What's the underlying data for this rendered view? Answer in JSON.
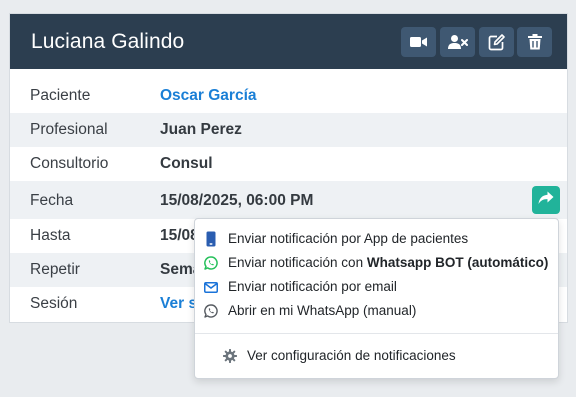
{
  "header": {
    "title": "Luciana Galindo",
    "buttons": [
      {
        "name": "video-call-button",
        "icon": "video-icon"
      },
      {
        "name": "remove-patient-button",
        "icon": "user-remove-icon"
      },
      {
        "name": "edit-button",
        "icon": "edit-icon"
      },
      {
        "name": "delete-button",
        "icon": "trash-icon"
      }
    ]
  },
  "details": {
    "paciente": {
      "label": "Paciente",
      "value": "Oscar García"
    },
    "profesional": {
      "label": "Profesional",
      "value": "Juan Perez"
    },
    "consultorio": {
      "label": "Consultorio",
      "value": "Consul"
    },
    "fecha": {
      "label": "Fecha",
      "value": "15/08/2025, 06:00 PM"
    },
    "hasta": {
      "label": "Hasta",
      "value": "15/08"
    },
    "repetir": {
      "label": "Repetir",
      "value": "Sema"
    },
    "sesion": {
      "label": "Sesión",
      "value": "Ver s"
    }
  },
  "notify_menu": {
    "app": "Enviar notificación por App de pacientes",
    "whatsapp_bot_prefix": "Enviar notificación con ",
    "whatsapp_bot_bold": "Whatsapp BOT (automático)",
    "email": "Enviar notificación por email",
    "whatsapp_manual": "Abrir en mi WhatsApp (manual)",
    "settings": "Ver configuración de notificaciones"
  },
  "colors": {
    "header_bg": "#2c3e50",
    "header_button_bg": "#3f5872",
    "link": "#1a7fd6",
    "share_button": "#21b39a",
    "whatsapp_green": "#25c05a",
    "app_icon_blue": "#2a5db0",
    "email_icon_blue": "#1a73d9"
  }
}
